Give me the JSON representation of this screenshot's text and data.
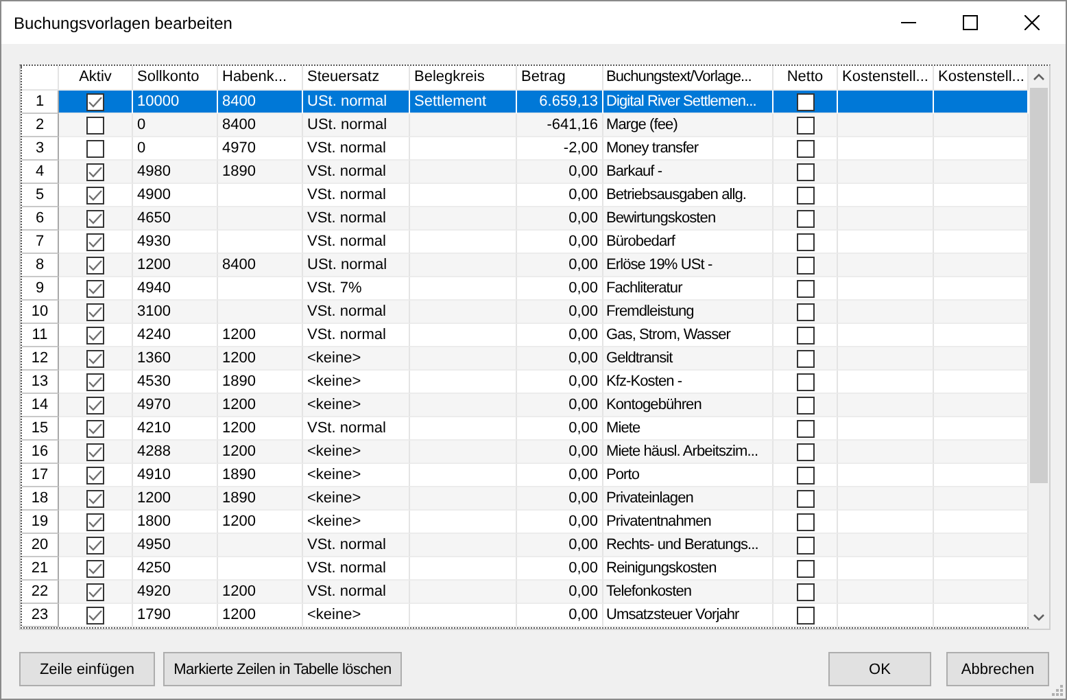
{
  "window": {
    "title": "Buchungsvorlagen bearbeiten"
  },
  "table": {
    "columns": [
      "Aktiv",
      "Sollkonto",
      "Habenk...",
      "Steuersatz",
      "Belegkreis",
      "Betrag",
      "Buchungstext/Vorlage...",
      "Netto",
      "Kostenstell...",
      "Kostenstell..."
    ],
    "rows": [
      {
        "number": "1",
        "selected": true,
        "aktiv": true,
        "sollkonto": "10000",
        "habenkonto": "8400",
        "steuersatz": "USt. normal",
        "belegkreis": "Settlement",
        "betrag": "6.659,13",
        "buchungstext": "Digital River Settlemen...",
        "netto": false
      },
      {
        "number": "2",
        "selected": false,
        "aktiv": false,
        "sollkonto": "0",
        "habenkonto": "8400",
        "steuersatz": "USt. normal",
        "betrag": "-641,16",
        "buchungstext": "Marge (fee)",
        "netto": false
      },
      {
        "number": "3",
        "selected": false,
        "aktiv": false,
        "sollkonto": "0",
        "habenkonto": "4970",
        "steuersatz": "VSt. normal",
        "betrag": "-2,00",
        "buchungstext": "Money transfer",
        "netto": false
      },
      {
        "number": "4",
        "selected": false,
        "aktiv": true,
        "sollkonto": "4980",
        "habenkonto": "1890",
        "steuersatz": "VSt. normal",
        "betrag": "0,00",
        "buchungstext": "Barkauf -",
        "netto": false
      },
      {
        "number": "5",
        "selected": false,
        "aktiv": true,
        "sollkonto": "4900",
        "steuersatz": "VSt. normal",
        "betrag": "0,00",
        "buchungstext": "Betriebsausgaben allg.",
        "netto": false
      },
      {
        "number": "6",
        "selected": false,
        "aktiv": true,
        "sollkonto": "4650",
        "steuersatz": "VSt. normal",
        "betrag": "0,00",
        "buchungstext": "Bewirtungskosten",
        "netto": false
      },
      {
        "number": "7",
        "selected": false,
        "aktiv": true,
        "sollkonto": "4930",
        "steuersatz": "VSt. normal",
        "betrag": "0,00",
        "buchungstext": "Bürobedarf",
        "netto": false
      },
      {
        "number": "8",
        "selected": false,
        "aktiv": true,
        "sollkonto": "1200",
        "habenkonto": "8400",
        "steuersatz": "USt. normal",
        "betrag": "0,00",
        "buchungstext": "Erlöse 19% USt -",
        "netto": false
      },
      {
        "number": "9",
        "selected": false,
        "aktiv": true,
        "sollkonto": "4940",
        "steuersatz": "VSt. 7%",
        "betrag": "0,00",
        "buchungstext": "Fachliteratur",
        "netto": false
      },
      {
        "number": "10",
        "selected": false,
        "aktiv": true,
        "sollkonto": "3100",
        "steuersatz": "VSt. normal",
        "betrag": "0,00",
        "buchungstext": "Fremdleistung",
        "netto": false
      },
      {
        "number": "11",
        "selected": false,
        "aktiv": true,
        "sollkonto": "4240",
        "habenkonto": "1200",
        "steuersatz": "VSt. normal",
        "betrag": "0,00",
        "buchungstext": "Gas, Strom, Wasser",
        "netto": false
      },
      {
        "number": "12",
        "selected": false,
        "aktiv": true,
        "sollkonto": "1360",
        "habenkonto": "1200",
        "steuersatz": "<keine>",
        "betrag": "0,00",
        "buchungstext": "Geldtransit",
        "netto": false
      },
      {
        "number": "13",
        "selected": false,
        "aktiv": true,
        "sollkonto": "4530",
        "habenkonto": "1890",
        "steuersatz": "<keine>",
        "betrag": "0,00",
        "buchungstext": "Kfz-Kosten -",
        "netto": false
      },
      {
        "number": "14",
        "selected": false,
        "aktiv": true,
        "sollkonto": "4970",
        "habenkonto": "1200",
        "steuersatz": "<keine>",
        "betrag": "0,00",
        "buchungstext": "Kontogebühren",
        "netto": false
      },
      {
        "number": "15",
        "selected": false,
        "aktiv": true,
        "sollkonto": "4210",
        "habenkonto": "1200",
        "steuersatz": "VSt. normal",
        "betrag": "0,00",
        "buchungstext": "Miete",
        "netto": false
      },
      {
        "number": "16",
        "selected": false,
        "aktiv": true,
        "sollkonto": "4288",
        "habenkonto": "1200",
        "steuersatz": "<keine>",
        "betrag": "0,00",
        "buchungstext": "Miete häusl. Arbeitszim...",
        "netto": false
      },
      {
        "number": "17",
        "selected": false,
        "aktiv": true,
        "sollkonto": "4910",
        "habenkonto": "1890",
        "steuersatz": "<keine>",
        "betrag": "0,00",
        "buchungstext": "Porto",
        "netto": false
      },
      {
        "number": "18",
        "selected": false,
        "aktiv": true,
        "sollkonto": "1200",
        "habenkonto": "1890",
        "steuersatz": "<keine>",
        "betrag": "0,00",
        "buchungstext": "Privateinlagen",
        "netto": false
      },
      {
        "number": "19",
        "selected": false,
        "aktiv": true,
        "sollkonto": "1800",
        "habenkonto": "1200",
        "steuersatz": "<keine>",
        "betrag": "0,00",
        "buchungstext": "Privatentnahmen",
        "netto": false
      },
      {
        "number": "20",
        "selected": false,
        "aktiv": true,
        "sollkonto": "4950",
        "steuersatz": "VSt. normal",
        "betrag": "0,00",
        "buchungstext": "Rechts- und Beratungs...",
        "netto": false
      },
      {
        "number": "21",
        "selected": false,
        "aktiv": true,
        "sollkonto": "4250",
        "steuersatz": "VSt. normal",
        "betrag": "0,00",
        "buchungstext": "Reinigungskosten",
        "netto": false
      },
      {
        "number": "22",
        "selected": false,
        "aktiv": true,
        "sollkonto": "4920",
        "habenkonto": "1200",
        "steuersatz": "VSt. normal",
        "betrag": "0,00",
        "buchungstext": "Telefonkosten",
        "netto": false
      },
      {
        "number": "23",
        "selected": false,
        "aktiv": true,
        "sollkonto": "1790",
        "habenkonto": "1200",
        "steuersatz": "<keine>",
        "betrag": "0,00",
        "buchungstext": "Umsatzsteuer Vorjahr",
        "netto": false
      }
    ]
  },
  "buttons_left": [
    "Zeile einfügen",
    "Markierte Zeilen in Tabelle löschen"
  ],
  "buttons_right": [
    "OK",
    "Abbrechen"
  ]
}
